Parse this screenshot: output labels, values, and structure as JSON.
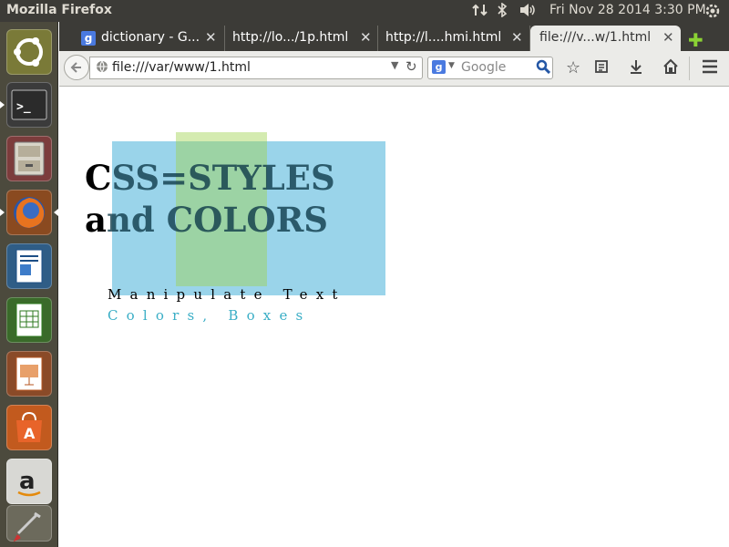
{
  "top_panel": {
    "window_title": "Mozilla Firefox",
    "clock": "Fri Nov 28 2014  3:30 PM"
  },
  "launcher": {
    "items": [
      {
        "name": "Dash Home",
        "icon": "ubuntu-logo-icon"
      },
      {
        "name": "Terminal",
        "icon": "terminal-icon"
      },
      {
        "name": "Files",
        "icon": "file-cabinet-icon"
      },
      {
        "name": "Firefox Web Browser",
        "icon": "firefox-icon"
      },
      {
        "name": "LibreOffice Writer",
        "icon": "writer-icon"
      },
      {
        "name": "LibreOffice Calc",
        "icon": "calc-icon"
      },
      {
        "name": "LibreOffice Impress",
        "icon": "impress-icon"
      },
      {
        "name": "Ubuntu Software Center",
        "icon": "software-center-icon"
      },
      {
        "name": "Amazon",
        "icon": "amazon-icon"
      },
      {
        "name": "System Settings",
        "icon": "settings-icon"
      }
    ]
  },
  "browser": {
    "tabs": [
      {
        "label": "dictionary - G...",
        "active": false,
        "icon": "google-favicon-icon"
      },
      {
        "label": "http://lo.../1p.html",
        "active": false
      },
      {
        "label": "http://l....hmi.html",
        "active": false
      },
      {
        "label": "file:///v...w/1.html",
        "active": true
      }
    ],
    "url": "file:///var/www/1.html",
    "search_engine": "Google",
    "search_placeholder": "Google"
  },
  "page": {
    "heading_lead1": "C",
    "heading_rest1": "SS=STYLES",
    "heading_lead2": "a",
    "heading_rest2": "nd COLORS",
    "subtitle1": "Manipulate Text",
    "subtitle2": "Colors, Boxes",
    "colors": {
      "blue_box": "#9ad4ea",
      "green_box": "#a0d250",
      "subtitle2": "#3aaec6"
    }
  }
}
